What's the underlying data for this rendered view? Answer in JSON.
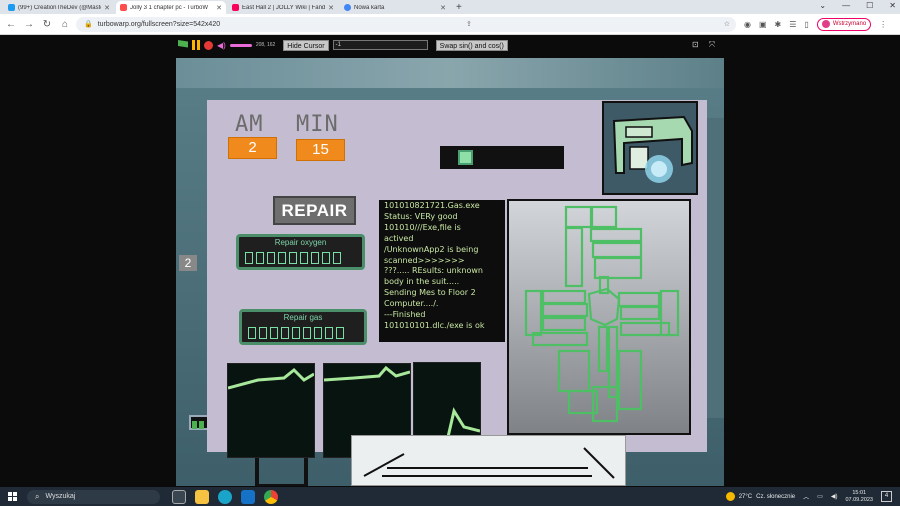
{
  "browser": {
    "tabs": [
      {
        "title": "(99+) CreationTheDev (@Mastod",
        "favicon_color": "#1d9bf0"
      },
      {
        "title": "Jolly 3 1 chapter pc - TurboW",
        "favicon_color": "#ff4c4c",
        "active": true
      },
      {
        "title": "East Hall 2 | JOLLY Wiki | Fandom",
        "favicon_color": "#fa005a"
      },
      {
        "title": "Nowa karta",
        "favicon_color": "#4285f4"
      }
    ],
    "new_tab": "+",
    "url": "turbowarp.org/fullscreen?size=542x420",
    "profile_initial": "Z",
    "profile_label": "Wstrzymano"
  },
  "turbowarp": {
    "coords": "208, 162",
    "hide_cursor_label": "Hide Cursor",
    "input_value": "-1",
    "swap_label": "Swap sin() and cos()"
  },
  "game": {
    "am_label": "AM",
    "am_value": "2",
    "min_label": "MIN",
    "min_value": "15",
    "repair_button": "REPAIR",
    "oxygen_label": "Repair oxygen",
    "gas_label": "Repair gas",
    "oxygen_level": 8,
    "gas_level": 8,
    "side_number": "2",
    "terminal_lines": [
      "101010821721.Gas.exe",
      "Status: VERy good",
      "101010///Exe,file is",
      "actived",
      "/UnknownApp2 is being",
      "scanned>>>>>>>",
      "???..... REsults: unknown",
      "body in the suit.....",
      "Sending Mes to Floor 2",
      "Computer..../.",
      "---Finished",
      "101010101.dlc./exe is ok"
    ]
  },
  "taskbar": {
    "search_placeholder": "Wyszukaj",
    "temperature": "27°C",
    "weather": "Cz. słonecznie",
    "time": "15:01",
    "date": "07.09.2023",
    "notifications": "4"
  }
}
